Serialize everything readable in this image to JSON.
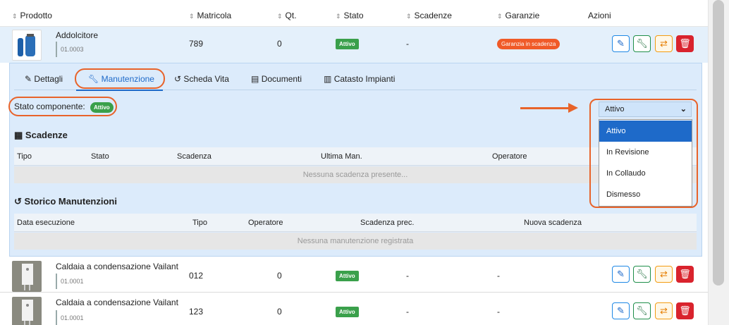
{
  "columns": {
    "prodotto": "Prodotto",
    "matricola": "Matricola",
    "qt": "Qt.",
    "stato": "Stato",
    "scadenze": "Scadenze",
    "garanzie": "Garanzie",
    "azioni": "Azioni"
  },
  "rows": [
    {
      "name": "Addolcitore",
      "code": "01.0003",
      "matricola": "789",
      "qt": "0",
      "stato": "Attivo",
      "scadenze": "-",
      "garanzie": "Garanzia in scadenza"
    },
    {
      "name": "Caldaia a condensazione Vailant",
      "code": "01.0001",
      "matricola": "012",
      "qt": "0",
      "stato": "Attivo",
      "scadenze": "-",
      "garanzie": "-"
    },
    {
      "name": "Caldaia a condensazione Vailant",
      "code": "01.0001",
      "matricola": "123",
      "qt": "0",
      "stato": "Attivo",
      "scadenze": "-",
      "garanzie": "-"
    }
  ],
  "tabs": [
    "Dettagli",
    "Manutenzione",
    "Scheda Vita",
    "Documenti",
    "Catasto Impianti"
  ],
  "stato_componente": {
    "label": "Stato componente:",
    "badge": "Attivo"
  },
  "select": {
    "value": "Attivo",
    "options": [
      "Attivo",
      "In Revisione",
      "In Collaudo",
      "Dismesso"
    ]
  },
  "scadenze_section": {
    "title": "Scadenze",
    "headers": [
      "Tipo",
      "Stato",
      "Scadenza",
      "Ultima Man.",
      "Operatore"
    ],
    "empty": "Nessuna scadenza presente..."
  },
  "storico_section": {
    "title": "Storico Manutenzioni",
    "headers": [
      "Data esecuzione",
      "Tipo",
      "Operatore",
      "Scadenza prec.",
      "Nuova scadenza"
    ],
    "empty": "Nessuna manutenzione registrata"
  },
  "colors": {
    "accent": "#1e6ac9",
    "success": "#3aa04b",
    "warning": "#f05a28",
    "danger": "#d9232d",
    "annotation": "#e8632a"
  }
}
